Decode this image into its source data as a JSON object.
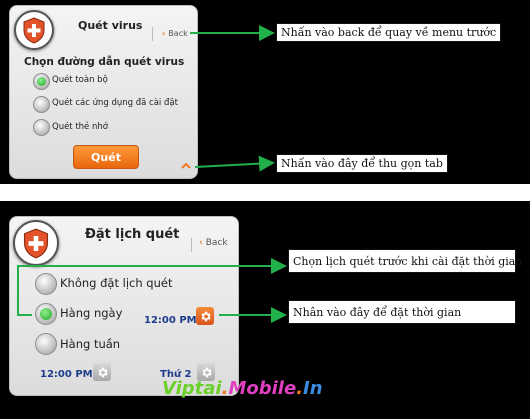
{
  "top_panel": {
    "title": "Quét virus",
    "back_label": "Back",
    "subtitle": "Chọn đường dẫn quét virus",
    "options": [
      {
        "label": "Quét toàn bộ",
        "selected": true
      },
      {
        "label": "Quét các ứng dụng đã cài đặt",
        "selected": false
      },
      {
        "label": "Quét thẻ nhớ",
        "selected": false
      }
    ],
    "scan_button": "Quét",
    "collapse_icon": "chevron-up-icon"
  },
  "bottom_panel": {
    "title": "Đặt lịch quét",
    "back_label": "Back",
    "options": [
      {
        "label": "Không đặt lịch quét",
        "selected": false
      },
      {
        "label": "Hàng ngày",
        "selected": true
      },
      {
        "label": "Hàng tuần",
        "selected": false
      }
    ],
    "daily_time": "12:00 PM",
    "weekly_time": "12:00 PM",
    "weekly_day": "Thứ 2"
  },
  "annotations": {
    "back_note": "Nhấn vào back để quay về menu trước",
    "collapse_note": "Nhấn vào đây để thu gọn tab",
    "schedule_note": "Chọn lịch quét trước khi cài đặt thời gian",
    "time_note": "Nhân vào đây để đặt thời gian"
  },
  "watermark": {
    "parts": [
      "Viptai",
      ".",
      "Mobile",
      ".",
      "In"
    ]
  },
  "colors": {
    "accent": "#f07820",
    "arrow": "#22b04a",
    "radio_on": "#22a522",
    "time_text": "#1e3c8c"
  }
}
